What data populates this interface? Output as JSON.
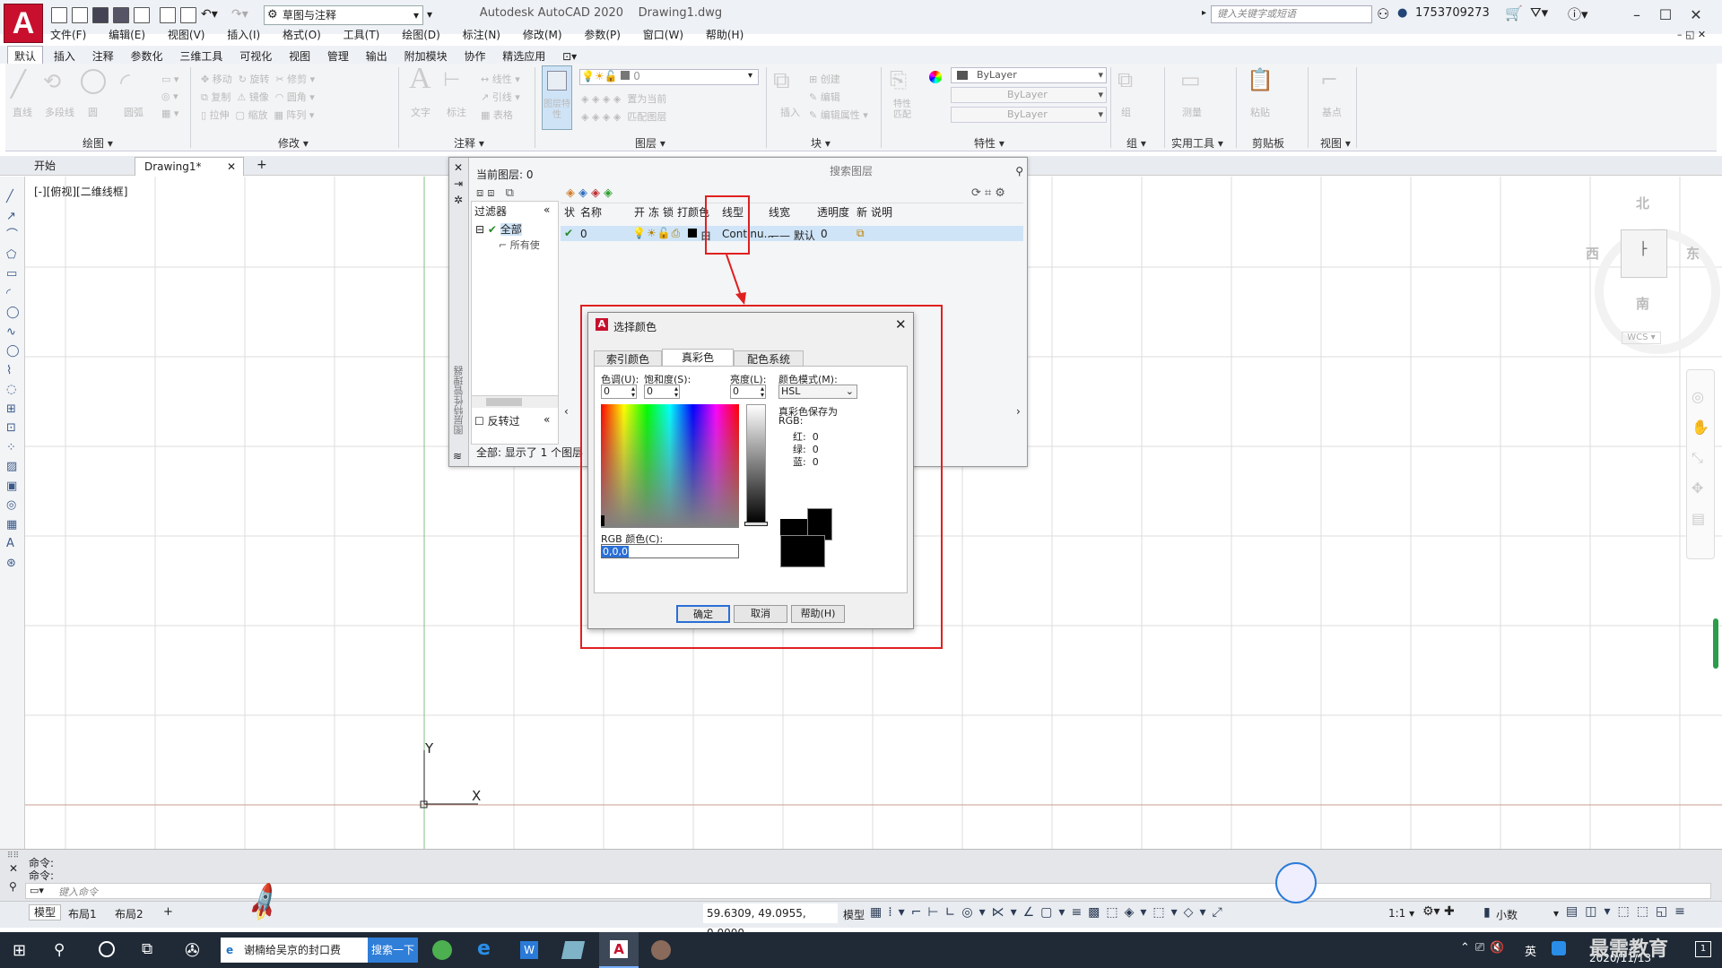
{
  "app": {
    "title": "Autodesk AutoCAD 2020",
    "doc": "Drawing1.dwg",
    "workspace": "草图与注释",
    "search_placeholder": "键入关键字或短语",
    "user": "1753709273",
    "logo": "A"
  },
  "menu": [
    "文件(F)",
    "编辑(E)",
    "视图(V)",
    "插入(I)",
    "格式(O)",
    "工具(T)",
    "绘图(D)",
    "标注(N)",
    "修改(M)",
    "参数(P)",
    "窗口(W)",
    "帮助(H)"
  ],
  "ribbon_tabs": [
    "默认",
    "插入",
    "注释",
    "参数化",
    "三维工具",
    "可视化",
    "视图",
    "管理",
    "输出",
    "附加模块",
    "协作",
    "精选应用"
  ],
  "ribbon": {
    "draw": {
      "title": "绘图",
      "tools": [
        "直线",
        "多段线",
        "圆",
        "圆弧"
      ]
    },
    "modify": {
      "title": "修改",
      "tools": [
        "移动",
        "旋转",
        "修剪",
        "复制",
        "镜像",
        "圆角",
        "拉伸",
        "缩放",
        "阵列"
      ]
    },
    "annotation": {
      "title": "注释",
      "tools": [
        "文字",
        "标注",
        "线性",
        "引线",
        "表格"
      ]
    },
    "layers": {
      "title": "图层",
      "current": "0",
      "tools": [
        "图层特性",
        "置为当前",
        "匹配图层"
      ]
    },
    "block": {
      "title": "块",
      "tools": [
        "插入",
        "创建",
        "编辑",
        "编辑属性"
      ]
    },
    "properties": {
      "title": "特性",
      "tools": [
        "特性匹配"
      ],
      "bylayer": [
        "ByLayer",
        "ByLayer",
        "ByLayer"
      ]
    },
    "groups": {
      "title": "组",
      "tools": [
        "组"
      ]
    },
    "utilities": {
      "title": "实用工具",
      "tools": [
        "测量"
      ]
    },
    "clipboard": {
      "title": "剪贴板",
      "tools": [
        "粘贴"
      ]
    },
    "view": {
      "title": "视图",
      "tools": [
        "基点"
      ]
    }
  },
  "doc_tabs": [
    "开始",
    "Drawing1*"
  ],
  "viewport_label": "[-][俯视][二维线框]",
  "viewcube": {
    "north": "北",
    "south": "南",
    "east": "东",
    "west": "西",
    "wcs": "WCS"
  },
  "layer_palette": {
    "current_layer": "当前图层: 0",
    "search_placeholder": "搜索图层",
    "filter_title": "过滤器",
    "tree": [
      "全部",
      "所有使"
    ],
    "invert": "反转过",
    "side_title": "图层特性管理器",
    "status": "全部: 显示了 1 个图层",
    "columns": [
      "状",
      "名称",
      "开",
      "冻",
      "锁",
      "打",
      "颜色",
      "线型",
      "线宽",
      "透明度",
      "新",
      "说明"
    ],
    "row": {
      "name": "0",
      "color": "白",
      "linetype": "Continu...",
      "lineweight": "默认",
      "transparency": "0"
    }
  },
  "color_dialog": {
    "title": "选择颜色",
    "tabs": [
      "索引颜色",
      "真彩色",
      "配色系统"
    ],
    "hue_label": "色调(U):",
    "hue": "0",
    "sat_label": "饱和度(S):",
    "sat": "0",
    "lum_label": "亮度(L):",
    "lum": "0",
    "mode_label": "颜色模式(M):",
    "mode": "HSL",
    "saved_as": "真彩色保存为",
    "rgb_label": "RGB:",
    "red_label": "红:",
    "red": "0",
    "green_label": "绿:",
    "green": "0",
    "blue_label": "蓝:",
    "blue": "0",
    "rgb_color_label": "RGB 颜色(C):",
    "rgb_color": "0,0,0",
    "ok": "确定",
    "cancel": "取消",
    "help": "帮助(H)"
  },
  "command": {
    "line1": "命令:",
    "line2": "命令:",
    "placeholder": "键入命令"
  },
  "layout_tabs": [
    "模型",
    "布局1",
    "布局2"
  ],
  "status": {
    "coords": "59.6309, 49.0955, 0.0000",
    "model": "模型",
    "scale": "1:1",
    "units": "小数"
  },
  "axis": {
    "x": "X",
    "y": "Y"
  },
  "taskbar": {
    "tab_title": "谢楠给吴京的封口费",
    "search_btn": "搜索一下",
    "ime": "英",
    "date": "2020/11/13",
    "watermark": "最需教育"
  }
}
